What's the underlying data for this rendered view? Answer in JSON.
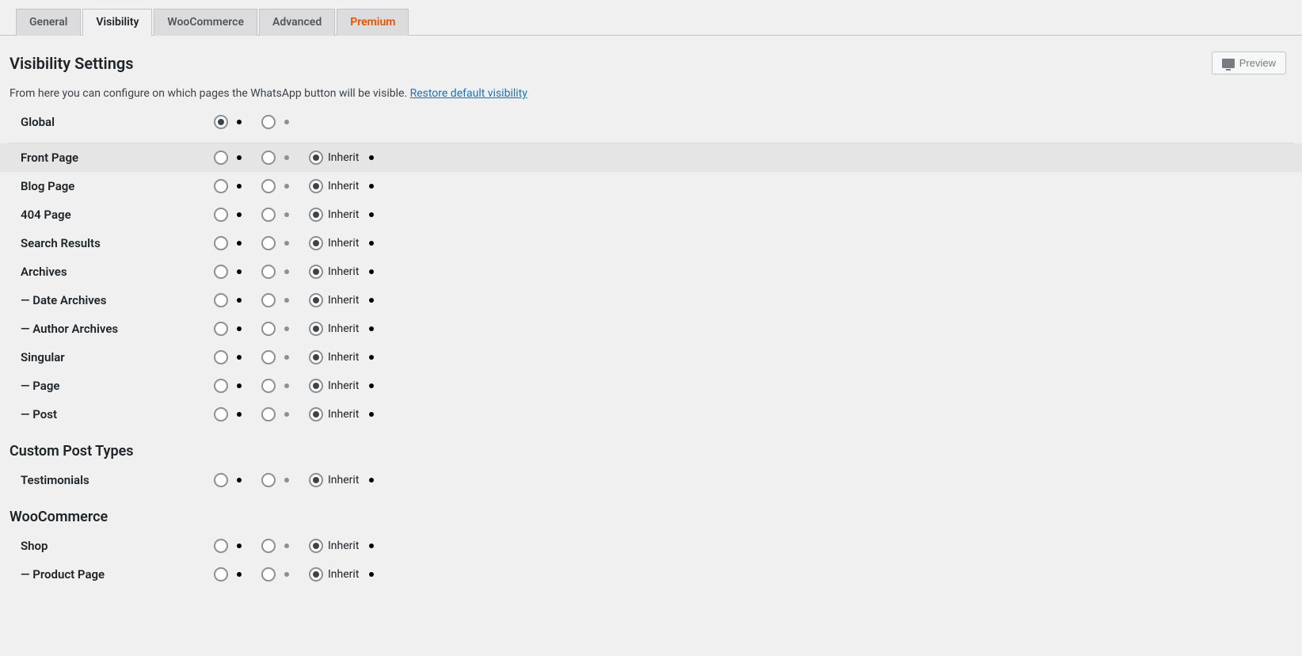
{
  "tabs": {
    "general": "General",
    "visibility": "Visibility",
    "woocommerce": "WooCommerce",
    "advanced": "Advanced",
    "premium": "Premium"
  },
  "preview_btn": "Preview",
  "page_title": "Visibility Settings",
  "description": "From here you can configure on which pages the WhatsApp button will be visible. ",
  "restore_link": "Restore default visibility",
  "inherit_label": "Inherit",
  "rows": {
    "global": "Global",
    "front_page": "Front Page",
    "blog_page": "Blog Page",
    "page_404": "404 Page",
    "search_results": "Search Results",
    "archives": "Archives",
    "date_archives": "— Date Archives",
    "author_archives": "— Author Archives",
    "singular": "Singular",
    "page": "— Page",
    "post": "— Post",
    "testimonials": "Testimonials",
    "shop": "Shop",
    "product_page": "— Product Page"
  },
  "sections": {
    "custom_post_types": "Custom Post Types",
    "woocommerce": "WooCommerce"
  }
}
